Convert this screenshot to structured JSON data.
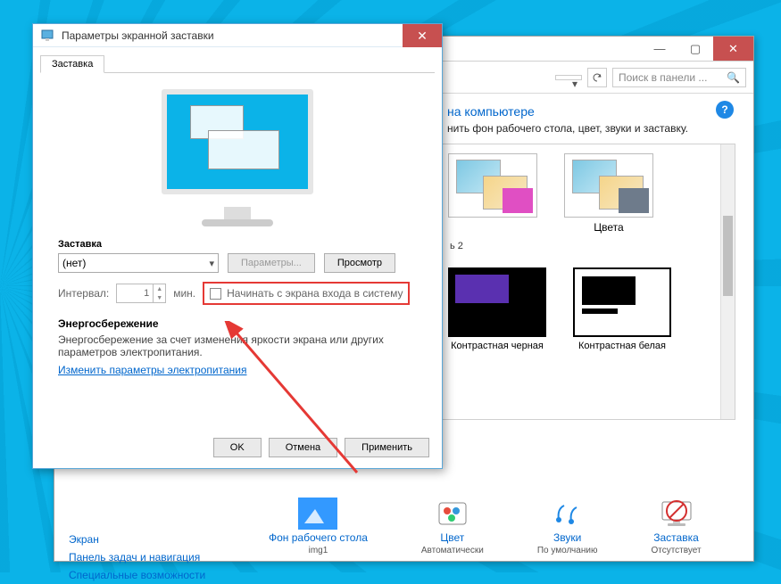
{
  "desktop": {},
  "controlPanel": {
    "window": {
      "minimize": "—",
      "maximize": "▢",
      "close": "✕"
    },
    "toolbar": {
      "dropdown_value": "",
      "refresh_tooltip": "Обновить",
      "search_placeholder": "Поиск в панели ...",
      "search_icon": "🔍"
    },
    "heading_suffix": "на компьютере",
    "subtitle_suffix": "нить фон рабочего стола, цвет, звуки и заставку.",
    "help": "?",
    "themes": {
      "row1_partial_label": "",
      "colors_label": "Цвета",
      "group2_suffix": "ь 2",
      "hc_black": "Контрастная черная",
      "hc_white": "Контрастная белая"
    },
    "sidebar": {
      "items": [
        "Экран",
        "Панель задач и навигация",
        "Специальные возможности"
      ]
    },
    "bottom": {
      "bg": {
        "label": "Фон рабочего стола",
        "value": "img1"
      },
      "color": {
        "label": "Цвет",
        "value": "Автоматически"
      },
      "sounds": {
        "label": "Звуки",
        "value": "По умолчанию"
      },
      "saver": {
        "label": "Заставка",
        "value": "Отсутствует"
      }
    }
  },
  "screensaver": {
    "title": "Параметры экранной заставки",
    "close": "✕",
    "tab": "Заставка",
    "section_label": "Заставка",
    "select_value": "(нет)",
    "params_btn": "Параметры...",
    "preview_btn": "Просмотр",
    "interval_label": "Интервал:",
    "interval_value": "1",
    "interval_unit": "мин.",
    "resume_label": "Начинать с экрана входа в систему",
    "energy": {
      "header": "Энергосбережение",
      "text": "Энергосбережение за счет изменения яркости экрана или других параметров электропитания.",
      "link": "Изменить параметры электропитания"
    },
    "buttons": {
      "ok": "OK",
      "cancel": "Отмена",
      "apply": "Применить"
    }
  }
}
